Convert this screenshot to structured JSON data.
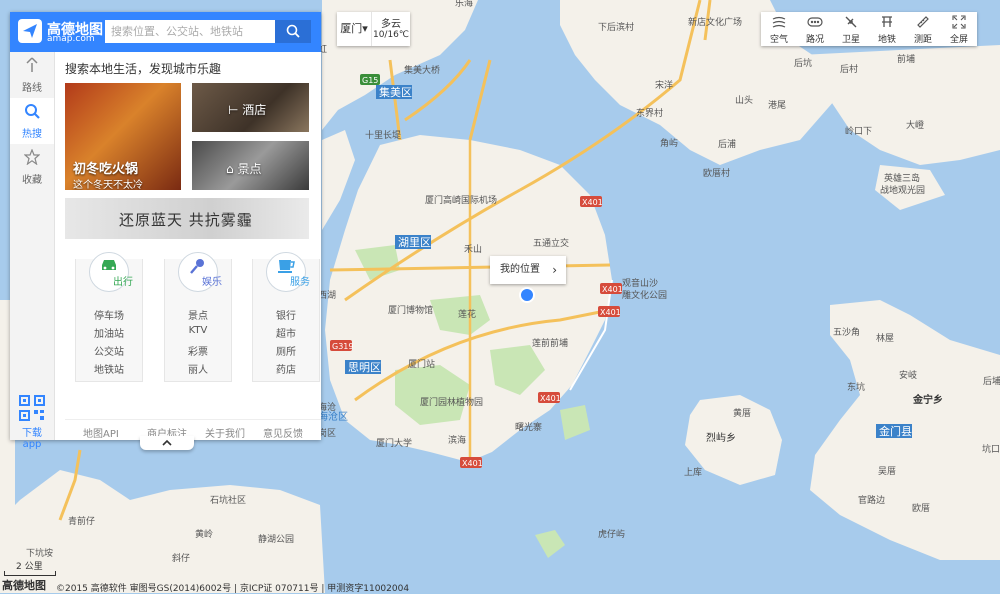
{
  "app": {
    "logo_text": "高德地图",
    "logo_sub": "amap.com",
    "bottom_logo": "高德地图"
  },
  "search": {
    "placeholder": "搜索位置、公交站、地铁站"
  },
  "sidebar": {
    "items": [
      {
        "label": "路线",
        "icon": "route-icon"
      },
      {
        "label": "热搜",
        "icon": "search-icon"
      },
      {
        "label": "收藏",
        "icon": "star-icon"
      }
    ],
    "download_label": "下载app"
  },
  "hot": {
    "title": "搜索本地生活，发现城市乐趣",
    "cards": [
      {
        "title": "初冬吃火锅",
        "subtitle": "这个冬天不太冷"
      },
      {
        "title": "酒店"
      },
      {
        "title": "景点"
      },
      {
        "title": "还原蓝天 共抗雾霾"
      }
    ],
    "categories": [
      {
        "name": "出行",
        "color": "#35a854",
        "links": [
          "停车场",
          "加油站",
          "公交站",
          "地铁站"
        ]
      },
      {
        "name": "娱乐",
        "color": "#5a73d6",
        "links": [
          "景点",
          "KTV",
          "彩票",
          "丽人"
        ]
      },
      {
        "name": "服务",
        "color": "#3aa0e6",
        "links": [
          "银行",
          "超市",
          "厕所",
          "药店"
        ]
      }
    ]
  },
  "footer": {
    "links": [
      "地图API",
      "商户标注",
      "关于我们",
      "意见反馈"
    ]
  },
  "weather": {
    "city": "厦门",
    "condition": "多云",
    "temp": "10/16℃"
  },
  "toolbar": {
    "tools": [
      {
        "label": "空气",
        "icon": "air-icon"
      },
      {
        "label": "路况",
        "icon": "traffic-icon"
      },
      {
        "label": "卫星",
        "icon": "satellite-icon"
      },
      {
        "label": "地铁",
        "icon": "subway-icon"
      },
      {
        "label": "测距",
        "icon": "ruler-icon"
      },
      {
        "label": "全屏",
        "icon": "fullscreen-icon"
      }
    ]
  },
  "map": {
    "my_location_label": "我的位置",
    "scale": "2 公里",
    "copyright": "©2015 高德软件 审图号GS(2014)6002号 | 京ICP证 070711号 | 甲测资字11002004",
    "districts": [
      "湖里区",
      "思明区",
      "集美区",
      "金门县",
      "海沧区"
    ],
    "road_shields": [
      "G15",
      "X401",
      "X401",
      "X401",
      "X401",
      "G319",
      "X401"
    ],
    "labels": [
      "乐海",
      "厦门高崎国际机场",
      "五通立交",
      "厦门博物馆",
      "莲花",
      "莲前前埔",
      "观音山沙",
      "雕文化公园",
      "厦门园林植物园",
      "厦门站",
      "曙光寨",
      "厦门大学",
      "滨海",
      "十里长堤",
      "集美大桥",
      "下后滨村",
      "新店文化广场",
      "后坑",
      "后村",
      "宋洋",
      "山头",
      "港尾",
      "东界村",
      "前埔",
      "大嶝",
      "岭口下",
      "角屿",
      "后浦",
      "欧厝村",
      "英雄三岛",
      "战地观光园",
      "五沙角",
      "林屋",
      "安岐",
      "东坑",
      "后埔",
      "金宁乡",
      "黄厝",
      "烈屿乡",
      "上库",
      "吴厝",
      "官路边",
      "欧厝",
      "坑口",
      "石坑社区",
      "黄岭",
      "静湖公园",
      "斜仔",
      "青前仔",
      "下坑垵",
      "虎仔屿",
      "禾山",
      "海沧",
      "西湖",
      "岗区",
      "虹"
    ]
  }
}
